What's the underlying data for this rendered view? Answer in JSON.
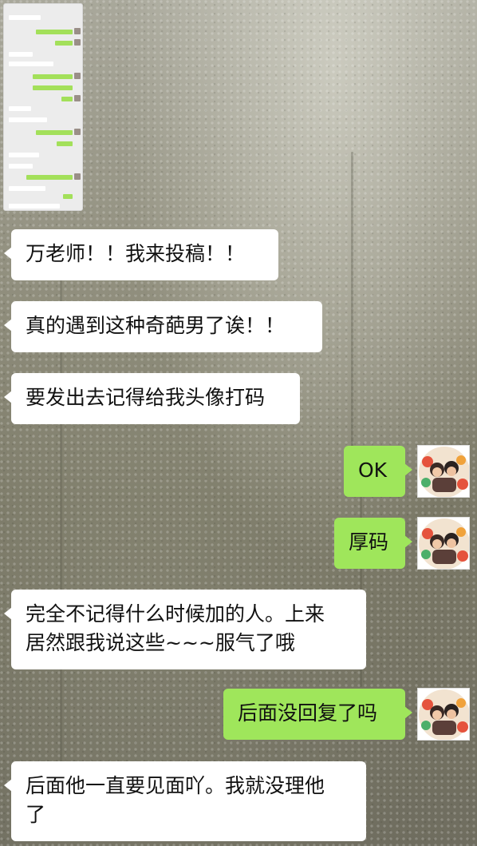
{
  "conversation": {
    "messages": [
      {
        "side": "in",
        "text": "万老师！！我来投稿！！"
      },
      {
        "side": "in",
        "text": "真的遇到这种奇葩男了诶！！"
      },
      {
        "side": "in",
        "text": "要发出去记得给我头像打码"
      },
      {
        "side": "out",
        "text": "OK"
      },
      {
        "side": "out",
        "text": "厚码"
      },
      {
        "side": "in",
        "text": "完全不记得什么时候加的人。上来\n居然跟我说这些~~~服气了哦"
      },
      {
        "side": "out",
        "text": "后面没回复了吗"
      },
      {
        "side": "in",
        "text": "后面他一直要见面吖。我就没理他\n了"
      }
    ]
  },
  "icons": {
    "avatar": "user-avatar-photo",
    "thumbnail": "chat-screenshot-thumbnail"
  },
  "colors": {
    "outgoing_bubble": "#9fe65b",
    "incoming_bubble": "#ffffff"
  }
}
